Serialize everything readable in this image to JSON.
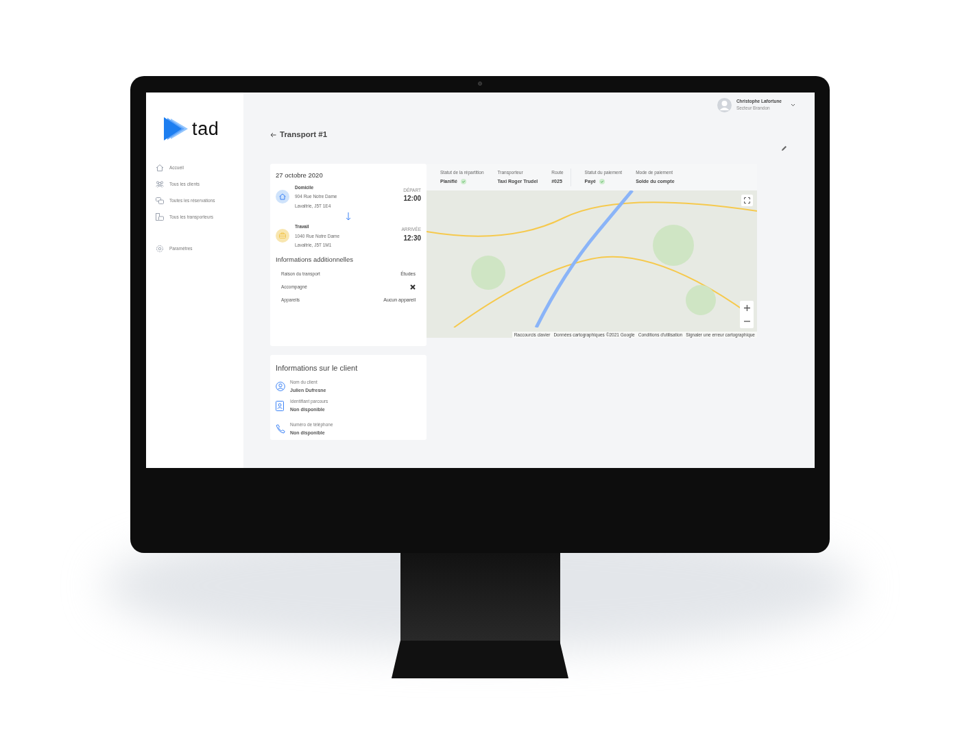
{
  "logo": {
    "text": "tad"
  },
  "sidebar": {
    "items": [
      {
        "kind": "home",
        "label": "Accueil"
      },
      {
        "kind": "clients",
        "label": "Tous les clients"
      },
      {
        "kind": "bookings",
        "label": "Toutes les réservations"
      },
      {
        "kind": "carriers",
        "label": "Tous les transporteurs"
      }
    ],
    "settings": {
      "label": "Paramètres"
    }
  },
  "user": {
    "name": "Christophe Lafortune",
    "sector": "Secteur Brandon"
  },
  "page": {
    "title": "Transport #1"
  },
  "trip": {
    "date": "27 octobre 2020",
    "stops": [
      {
        "kind": "home",
        "name": "Domicile",
        "address_1": "904 Rue Notre Dame",
        "address_2": "Lavaltrie, J5T 1E4",
        "time_label": "DÉPART",
        "time": "12:00"
      },
      {
        "kind": "work",
        "name": "Travail",
        "address_1": "1040 Rue Notre Dame",
        "address_2": "Lavaltrie, J5T 1M1",
        "time_label": "ARRIVÉE",
        "time": "12:30"
      }
    ]
  },
  "additional": {
    "title": "Informations additionnelles",
    "rows": [
      {
        "kind": "text",
        "label": "Raison du transport",
        "value": "Études"
      },
      {
        "kind": "flag",
        "label": "Accompagné",
        "value": false
      },
      {
        "kind": "text",
        "label": "Appareils",
        "value": "Aucun appareil"
      }
    ]
  },
  "statuses": [
    {
      "label": "Statut de la répartition",
      "value": "Planifié",
      "confirmed": true
    },
    {
      "label": "Transporteur",
      "value": "Taxi Roger Trudel",
      "confirmed": false
    },
    {
      "label": "Route",
      "value": "#025",
      "confirmed": false
    },
    {
      "label": "Statut du paiement",
      "value": "Payé",
      "confirmed": true
    },
    {
      "label": "Mode de paiement",
      "value": "Solde du compte",
      "confirmed": false
    }
  ],
  "map": {
    "attribution": [
      "Raccourcis clavier",
      "Données cartographiques ©2021 Google",
      "Conditions d'utilisation",
      "Signaler une erreur cartographique"
    ]
  },
  "client": {
    "title": "Informations sur le client",
    "fields": [
      {
        "kind": "person",
        "label": "Nom du client",
        "value": "Julien Dufresne"
      },
      {
        "kind": "id",
        "label": "Identifiant parcours",
        "value": "Non disponible"
      },
      {
        "kind": "phone",
        "label": "Numéro de téléphone",
        "value": "Non disponible"
      }
    ]
  }
}
